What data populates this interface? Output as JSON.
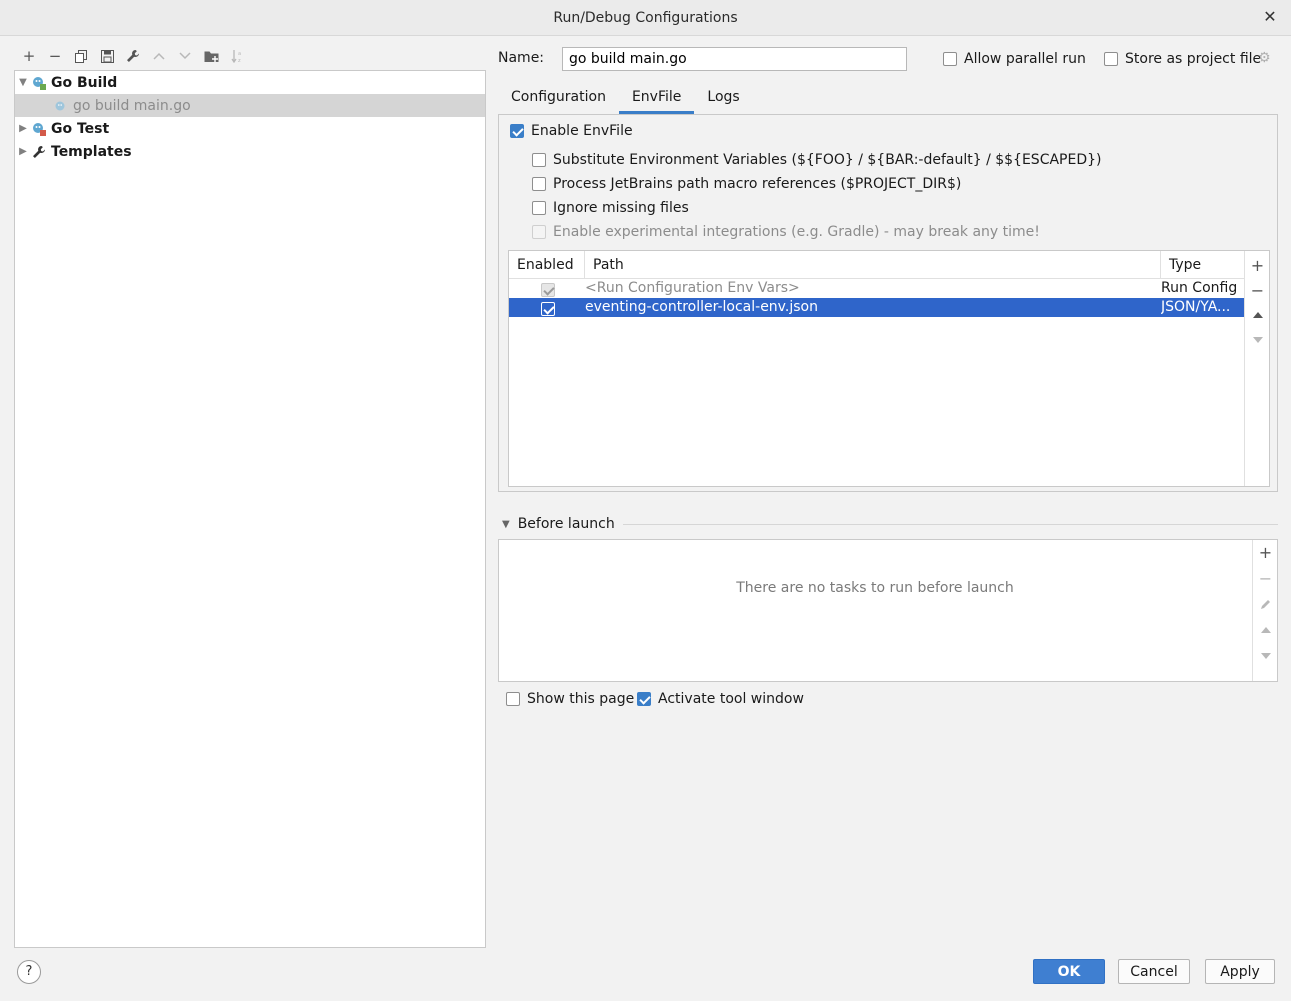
{
  "window": {
    "title": "Run/Debug Configurations"
  },
  "toolbar": {
    "add": "+",
    "remove": "−",
    "copy": "⧉",
    "save": "💾",
    "edit": "🔧",
    "up": "▲",
    "down": "▼",
    "folder": "📁",
    "sort": "⇅"
  },
  "tree": {
    "items": [
      {
        "label": "Go Build",
        "bold": true,
        "expanded": true
      },
      {
        "label": "go build main.go",
        "selected": true
      },
      {
        "label": "Go Test",
        "bold": true,
        "expanded": false
      },
      {
        "label": "Templates",
        "bold": true,
        "expanded": false
      }
    ]
  },
  "config": {
    "name_label": "Name:",
    "name_value": "go build main.go",
    "allow_parallel": "Allow parallel run",
    "store_project": "Store as project file"
  },
  "tabs": [
    "Configuration",
    "EnvFile",
    "Logs"
  ],
  "envfile": {
    "enable": "Enable EnvFile",
    "options": [
      "Substitute Environment Variables (${FOO} / ${BAR:-default} / $${ESCAPED})",
      "Process JetBrains path macro references ($PROJECT_DIR$)",
      "Ignore missing files",
      "Enable experimental integrations (e.g. Gradle) - may break any time!"
    ],
    "columns": {
      "enabled": "Enabled",
      "path": "Path",
      "type": "Type"
    },
    "rows": [
      {
        "path": "<Run Configuration Env Vars>",
        "type": "Run Config"
      },
      {
        "path": "eventing-controller-local-env.json",
        "type": "JSON/YA..."
      }
    ]
  },
  "before_launch": {
    "title": "Before launch",
    "empty": "There are no tasks to run before launch"
  },
  "options": {
    "show_page": "Show this page",
    "activate_tool": "Activate tool window"
  },
  "buttons": {
    "help": "?",
    "ok": "OK",
    "cancel": "Cancel",
    "apply": "Apply"
  },
  "colors": {
    "accent": "#3a7ec8",
    "selection": "#2f65ca"
  }
}
